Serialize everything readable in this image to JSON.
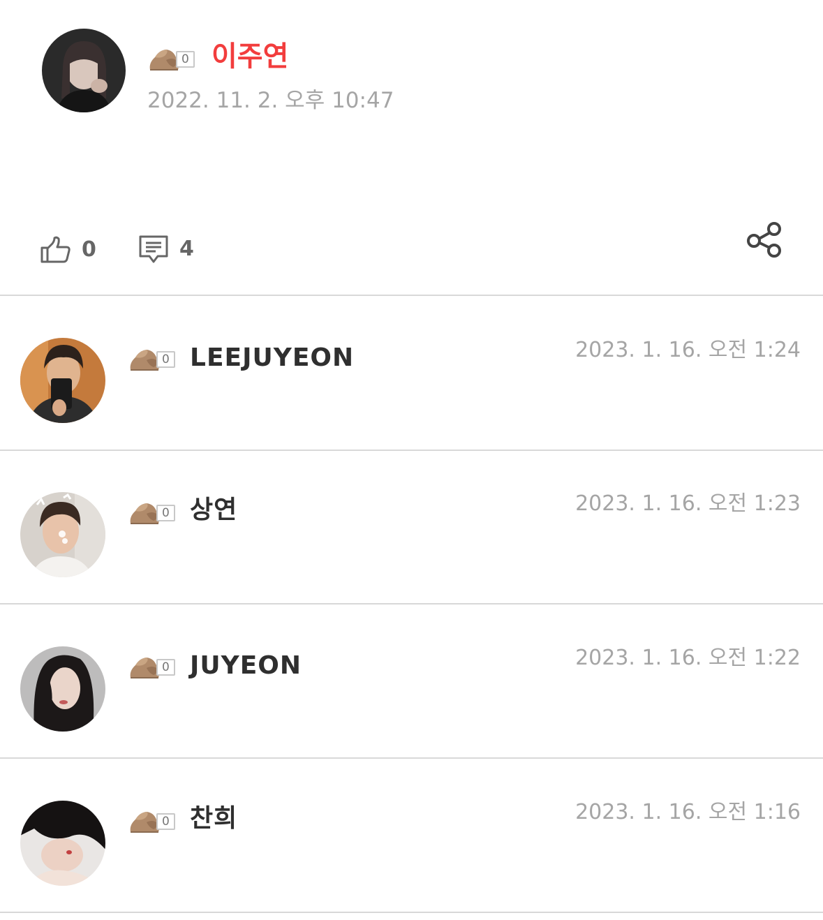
{
  "post": {
    "author": "이주연",
    "level": "0",
    "timestamp": "2022. 11. 2. 오후 10:47",
    "like_count": "0",
    "comment_count": "4",
    "author_color": "#f23d3d"
  },
  "comments": [
    {
      "author": "LEEJUYEON",
      "level": "0",
      "timestamp": "2023. 1. 16. 오전 1:24"
    },
    {
      "author": "상연",
      "level": "0",
      "timestamp": "2023. 1. 16. 오전 1:23"
    },
    {
      "author": "JUYEON",
      "level": "0",
      "timestamp": "2023. 1. 16. 오전 1:22"
    },
    {
      "author": "찬희",
      "level": "0",
      "timestamp": "2023. 1. 16. 오전 1:16"
    }
  ],
  "icons": {
    "level": "rock-icon",
    "like": "thumbs-up-icon",
    "comment": "comment-bubble-icon",
    "share": "share-icon"
  }
}
